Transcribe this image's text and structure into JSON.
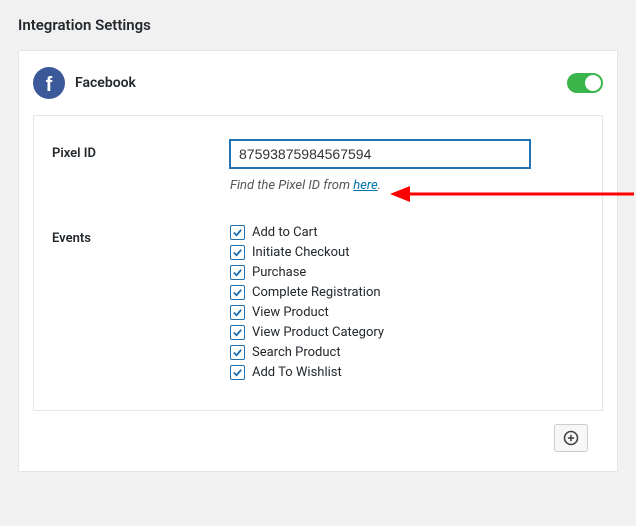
{
  "page_title": "Integration Settings",
  "provider": {
    "name": "Facebook",
    "enabled": true
  },
  "fields": {
    "pixel_id": {
      "label": "Pixel ID",
      "value": "87593875984567594",
      "help_prefix": "Find the Pixel ID from ",
      "help_link_text": "here",
      "help_suffix": "."
    },
    "events": {
      "label": "Events",
      "items": [
        {
          "label": "Add to Cart",
          "checked": true
        },
        {
          "label": "Initiate Checkout",
          "checked": true
        },
        {
          "label": "Purchase",
          "checked": true
        },
        {
          "label": "Complete Registration",
          "checked": true
        },
        {
          "label": "View Product",
          "checked": true
        },
        {
          "label": "View Product Category",
          "checked": true
        },
        {
          "label": "Search Product",
          "checked": true
        },
        {
          "label": "Add To Wishlist",
          "checked": true
        }
      ]
    }
  }
}
